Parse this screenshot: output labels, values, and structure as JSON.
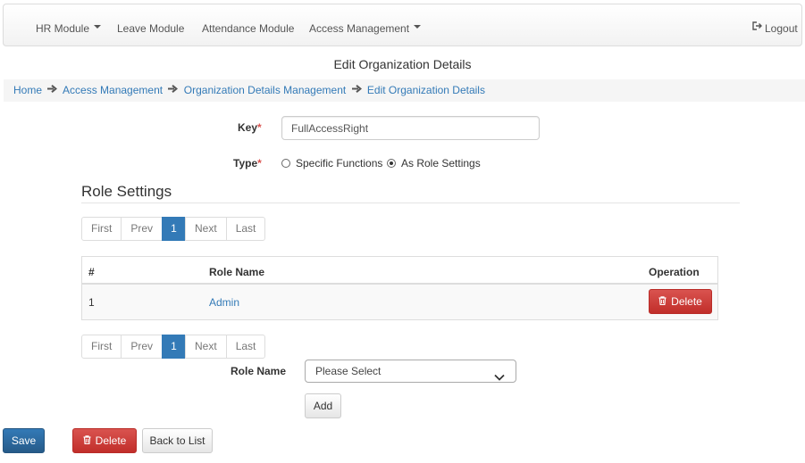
{
  "navbar": {
    "items": [
      {
        "label": "HR Module",
        "has_caret": true
      },
      {
        "label": "Leave Module",
        "has_caret": false
      },
      {
        "label": "Attendance Module",
        "has_caret": false
      },
      {
        "label": "Access Management",
        "has_caret": true
      }
    ],
    "logout_label": "Logout",
    "logout_icon": "logout-icon"
  },
  "page_title": "Edit Organization Details",
  "breadcrumb": {
    "items": [
      "Home",
      "Access Management",
      "Organization Details Management",
      "Edit Organization Details"
    ],
    "separator_icon": "arrow-right-icon"
  },
  "form": {
    "key_label": "Key",
    "key_value": "FullAccessRight",
    "required_marker": "*",
    "type_label": "Type",
    "type_options": [
      {
        "label": "Specific Functions",
        "checked": false
      },
      {
        "label": "As Role Settings",
        "checked": true
      }
    ]
  },
  "role_settings": {
    "title": "Role Settings",
    "pagination": {
      "first": "First",
      "prev": "Prev",
      "current": "1",
      "next": "Next",
      "last": "Last"
    },
    "table": {
      "headers": [
        "#",
        "Role Name",
        "Operation"
      ],
      "rows": [
        {
          "index": "1",
          "role_name": "Admin",
          "operation_label": "Delete"
        }
      ]
    },
    "role_name_label": "Role Name",
    "role_select_value": "Please Select",
    "add_label": "Add"
  },
  "footer": {
    "save_label": "Save",
    "delete_label": "Delete",
    "back_label": "Back to List"
  },
  "colors": {
    "link": "#337ab7",
    "primary": "#337ab7",
    "danger": "#d9534f",
    "breadcrumb_bg": "#f5f5f5"
  }
}
